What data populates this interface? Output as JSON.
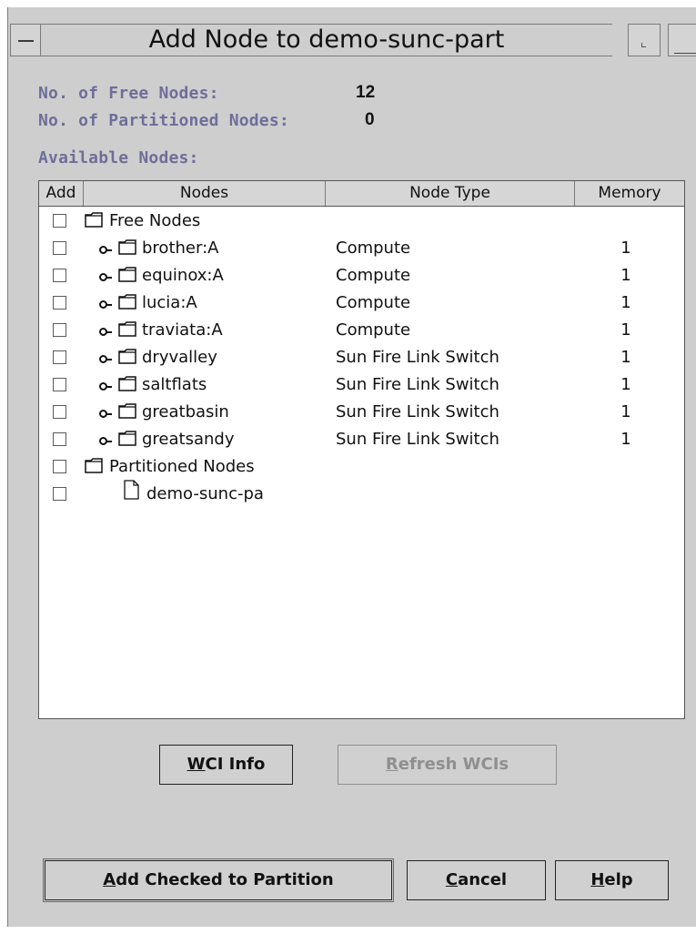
{
  "window": {
    "title": "Add Node to demo-sunc-part"
  },
  "info": {
    "free_label": "No. of Free Nodes:",
    "free_value": "12",
    "partitioned_label": "No. of Partitioned Nodes:",
    "partitioned_value": "0",
    "available_label": "Available Nodes:"
  },
  "table": {
    "columns": [
      "Add",
      "Nodes",
      "Node Type",
      "Memory"
    ],
    "rows": [
      {
        "kind": "group",
        "name": "Free Nodes",
        "type": "",
        "memory": ""
      },
      {
        "kind": "node",
        "name": "brother:A",
        "type": "Compute",
        "memory": "1"
      },
      {
        "kind": "node",
        "name": "equinox:A",
        "type": "Compute",
        "memory": "1"
      },
      {
        "kind": "node",
        "name": "lucia:A",
        "type": "Compute",
        "memory": "1"
      },
      {
        "kind": "node",
        "name": "traviata:A",
        "type": "Compute",
        "memory": "1"
      },
      {
        "kind": "node",
        "name": "dryvalley",
        "type": "Sun Fire Link Switch",
        "memory": "1"
      },
      {
        "kind": "node",
        "name": "saltflats",
        "type": "Sun Fire Link Switch",
        "memory": "1"
      },
      {
        "kind": "node",
        "name": "greatbasin",
        "type": "Sun Fire Link Switch",
        "memory": "1"
      },
      {
        "kind": "node",
        "name": "greatsandy",
        "type": "Sun Fire Link Switch",
        "memory": "1"
      },
      {
        "kind": "group",
        "name": "Partitioned Nodes",
        "type": "",
        "memory": ""
      },
      {
        "kind": "leaf",
        "name": "demo-sunc-pa",
        "type": "",
        "memory": ""
      }
    ]
  },
  "buttons": {
    "wci_info": {
      "mnemonic": "W",
      "rest": "CI Info"
    },
    "refresh_wcis": {
      "mnemonic": "R",
      "rest": "efresh WCIs"
    },
    "add_checked": {
      "mnemonic": "A",
      "rest": "dd Checked to Partition"
    },
    "cancel": {
      "mnemonic": "C",
      "rest": "ancel"
    },
    "help": {
      "mnemonic": "H",
      "rest": "elp"
    }
  },
  "colors": {
    "window_bg": "#cecece",
    "label_color": "#6e6e9a",
    "disabled_text": "#8f8f8f"
  },
  "icons": [
    "menu-icon",
    "minimize-icon",
    "maximize-icon",
    "folder-icon",
    "document-icon",
    "expand-handle-icon"
  ]
}
